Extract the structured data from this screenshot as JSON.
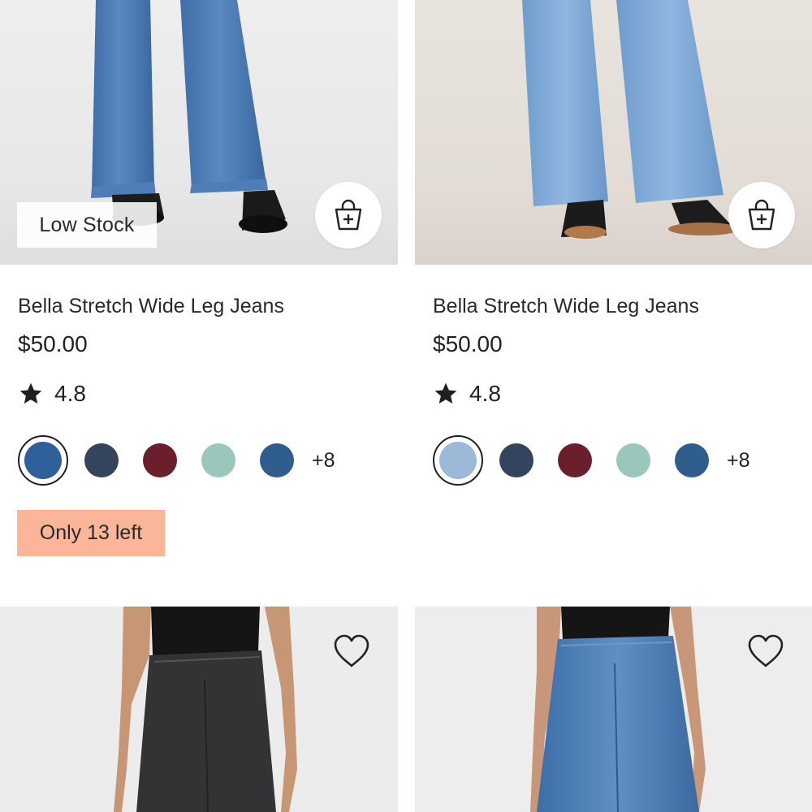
{
  "products": [
    {
      "title": "Bella Stretch Wide Leg Jeans",
      "price": "$50.00",
      "rating": "4.8",
      "badge": "Low Stock",
      "stock_note": "Only 13 left",
      "more_colors": "+8",
      "swatch_colors": [
        "#30609b",
        "#33445c",
        "#6b1e2b",
        "#9ac6bb",
        "#2e5d8e"
      ],
      "selected_swatch": 0
    },
    {
      "title": "Bella Stretch Wide Leg Jeans",
      "price": "$50.00",
      "rating": "4.8",
      "more_colors": "+8",
      "swatch_colors": [
        "#9cbad8",
        "#33445c",
        "#6b1e2b",
        "#9ac6bb",
        "#2e5d8e"
      ],
      "selected_swatch": 0
    }
  ],
  "icons": {
    "bag": "shopping-bag-plus-icon",
    "heart": "heart-outline-icon",
    "star": "star-icon"
  },
  "colors": {
    "stock_badge_bg": "#fbb69a",
    "text": "#222222"
  }
}
